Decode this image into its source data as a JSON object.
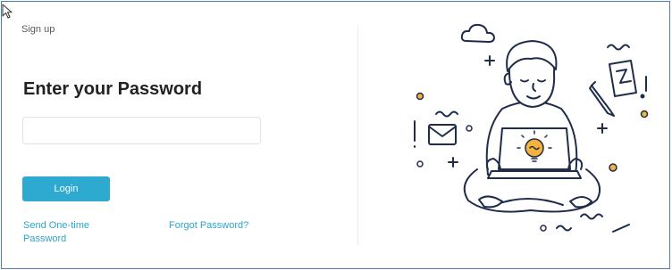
{
  "header": {
    "label": "Sign up"
  },
  "form": {
    "title": "Enter your Password",
    "password_value": "",
    "password_placeholder": "",
    "login_label": "Login",
    "otp_label": "Send One-time Password",
    "forgot_label": "Forgot Password?"
  },
  "colors": {
    "accent": "#2ea9cf",
    "link": "#2ea4cc",
    "frame_border": "#4a7fb8",
    "illustration_stroke": "#1f2d4a",
    "highlight": "#f5b23c"
  },
  "icons": {
    "cursor": "mouse-pointer-icon",
    "illustration": "person-with-laptop-illustration"
  }
}
